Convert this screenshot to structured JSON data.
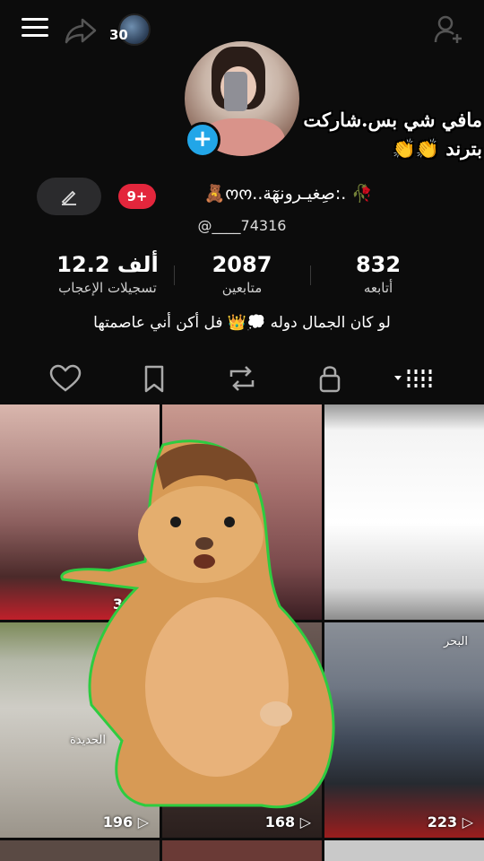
{
  "header": {
    "story_count": "30"
  },
  "overlay_caption": {
    "line1": "مافي شي بس.شاركت",
    "line2": "بترند 👏👏"
  },
  "profile": {
    "badge": "9+",
    "display_name": "🥀 .:صِغيـرونهٓة..ოო🧸",
    "handle": "@____74316"
  },
  "stats": [
    {
      "value": "832",
      "label": "أتابعه"
    },
    {
      "value": "2087",
      "label": "متابعين"
    },
    {
      "value": "12.2 ألف",
      "label": "تسجيلات الإعجاب"
    }
  ],
  "bio": "لو كان الجمال دوله 💭👑 فل أكن أني عاصمتها",
  "tabs": [
    "grid",
    "lock",
    "repost",
    "bookmark",
    "heart"
  ],
  "videos": [
    {
      "views": "34",
      "tag": ""
    },
    {
      "views": "",
      "tag": ""
    },
    {
      "views": "",
      "tag": ""
    },
    {
      "views": "196",
      "tag": "الحديدة"
    },
    {
      "views": "168",
      "tag": ""
    },
    {
      "views": "223",
      "tag": "البحر"
    }
  ],
  "colors": {
    "accent_blue": "#22a6e8",
    "badge_red": "#e3263c",
    "background": "#0c0c0c"
  }
}
